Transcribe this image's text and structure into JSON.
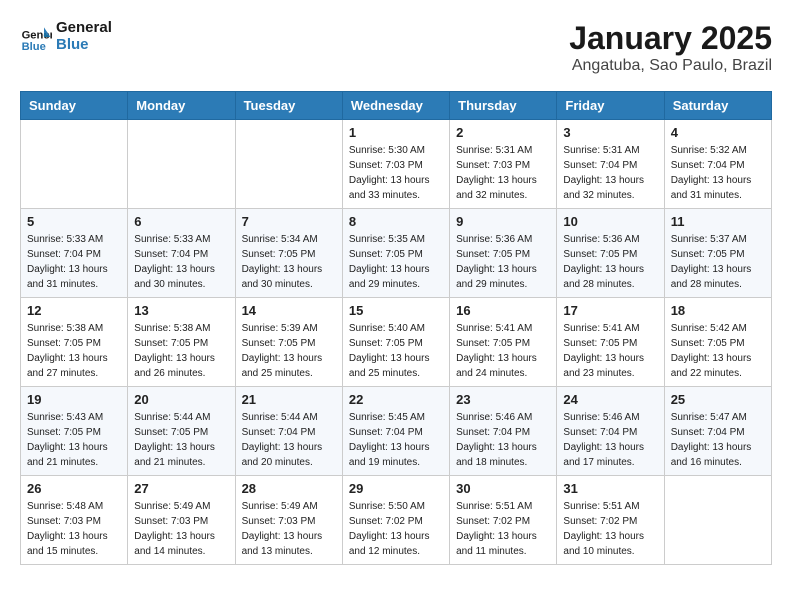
{
  "header": {
    "logo_line1": "General",
    "logo_line2": "Blue",
    "month": "January 2025",
    "location": "Angatuba, Sao Paulo, Brazil"
  },
  "weekdays": [
    "Sunday",
    "Monday",
    "Tuesday",
    "Wednesday",
    "Thursday",
    "Friday",
    "Saturday"
  ],
  "weeks": [
    [
      null,
      null,
      null,
      {
        "day": 1,
        "sunrise": "5:30 AM",
        "sunset": "7:03 PM",
        "daylight": "13 hours and 33 minutes."
      },
      {
        "day": 2,
        "sunrise": "5:31 AM",
        "sunset": "7:03 PM",
        "daylight": "13 hours and 32 minutes."
      },
      {
        "day": 3,
        "sunrise": "5:31 AM",
        "sunset": "7:04 PM",
        "daylight": "13 hours and 32 minutes."
      },
      {
        "day": 4,
        "sunrise": "5:32 AM",
        "sunset": "7:04 PM",
        "daylight": "13 hours and 31 minutes."
      }
    ],
    [
      {
        "day": 5,
        "sunrise": "5:33 AM",
        "sunset": "7:04 PM",
        "daylight": "13 hours and 31 minutes."
      },
      {
        "day": 6,
        "sunrise": "5:33 AM",
        "sunset": "7:04 PM",
        "daylight": "13 hours and 30 minutes."
      },
      {
        "day": 7,
        "sunrise": "5:34 AM",
        "sunset": "7:05 PM",
        "daylight": "13 hours and 30 minutes."
      },
      {
        "day": 8,
        "sunrise": "5:35 AM",
        "sunset": "7:05 PM",
        "daylight": "13 hours and 29 minutes."
      },
      {
        "day": 9,
        "sunrise": "5:36 AM",
        "sunset": "7:05 PM",
        "daylight": "13 hours and 29 minutes."
      },
      {
        "day": 10,
        "sunrise": "5:36 AM",
        "sunset": "7:05 PM",
        "daylight": "13 hours and 28 minutes."
      },
      {
        "day": 11,
        "sunrise": "5:37 AM",
        "sunset": "7:05 PM",
        "daylight": "13 hours and 28 minutes."
      }
    ],
    [
      {
        "day": 12,
        "sunrise": "5:38 AM",
        "sunset": "7:05 PM",
        "daylight": "13 hours and 27 minutes."
      },
      {
        "day": 13,
        "sunrise": "5:38 AM",
        "sunset": "7:05 PM",
        "daylight": "13 hours and 26 minutes."
      },
      {
        "day": 14,
        "sunrise": "5:39 AM",
        "sunset": "7:05 PM",
        "daylight": "13 hours and 25 minutes."
      },
      {
        "day": 15,
        "sunrise": "5:40 AM",
        "sunset": "7:05 PM",
        "daylight": "13 hours and 25 minutes."
      },
      {
        "day": 16,
        "sunrise": "5:41 AM",
        "sunset": "7:05 PM",
        "daylight": "13 hours and 24 minutes."
      },
      {
        "day": 17,
        "sunrise": "5:41 AM",
        "sunset": "7:05 PM",
        "daylight": "13 hours and 23 minutes."
      },
      {
        "day": 18,
        "sunrise": "5:42 AM",
        "sunset": "7:05 PM",
        "daylight": "13 hours and 22 minutes."
      }
    ],
    [
      {
        "day": 19,
        "sunrise": "5:43 AM",
        "sunset": "7:05 PM",
        "daylight": "13 hours and 21 minutes."
      },
      {
        "day": 20,
        "sunrise": "5:44 AM",
        "sunset": "7:05 PM",
        "daylight": "13 hours and 21 minutes."
      },
      {
        "day": 21,
        "sunrise": "5:44 AM",
        "sunset": "7:04 PM",
        "daylight": "13 hours and 20 minutes."
      },
      {
        "day": 22,
        "sunrise": "5:45 AM",
        "sunset": "7:04 PM",
        "daylight": "13 hours and 19 minutes."
      },
      {
        "day": 23,
        "sunrise": "5:46 AM",
        "sunset": "7:04 PM",
        "daylight": "13 hours and 18 minutes."
      },
      {
        "day": 24,
        "sunrise": "5:46 AM",
        "sunset": "7:04 PM",
        "daylight": "13 hours and 17 minutes."
      },
      {
        "day": 25,
        "sunrise": "5:47 AM",
        "sunset": "7:04 PM",
        "daylight": "13 hours and 16 minutes."
      }
    ],
    [
      {
        "day": 26,
        "sunrise": "5:48 AM",
        "sunset": "7:03 PM",
        "daylight": "13 hours and 15 minutes."
      },
      {
        "day": 27,
        "sunrise": "5:49 AM",
        "sunset": "7:03 PM",
        "daylight": "13 hours and 14 minutes."
      },
      {
        "day": 28,
        "sunrise": "5:49 AM",
        "sunset": "7:03 PM",
        "daylight": "13 hours and 13 minutes."
      },
      {
        "day": 29,
        "sunrise": "5:50 AM",
        "sunset": "7:02 PM",
        "daylight": "13 hours and 12 minutes."
      },
      {
        "day": 30,
        "sunrise": "5:51 AM",
        "sunset": "7:02 PM",
        "daylight": "13 hours and 11 minutes."
      },
      {
        "day": 31,
        "sunrise": "5:51 AM",
        "sunset": "7:02 PM",
        "daylight": "13 hours and 10 minutes."
      },
      null
    ]
  ]
}
